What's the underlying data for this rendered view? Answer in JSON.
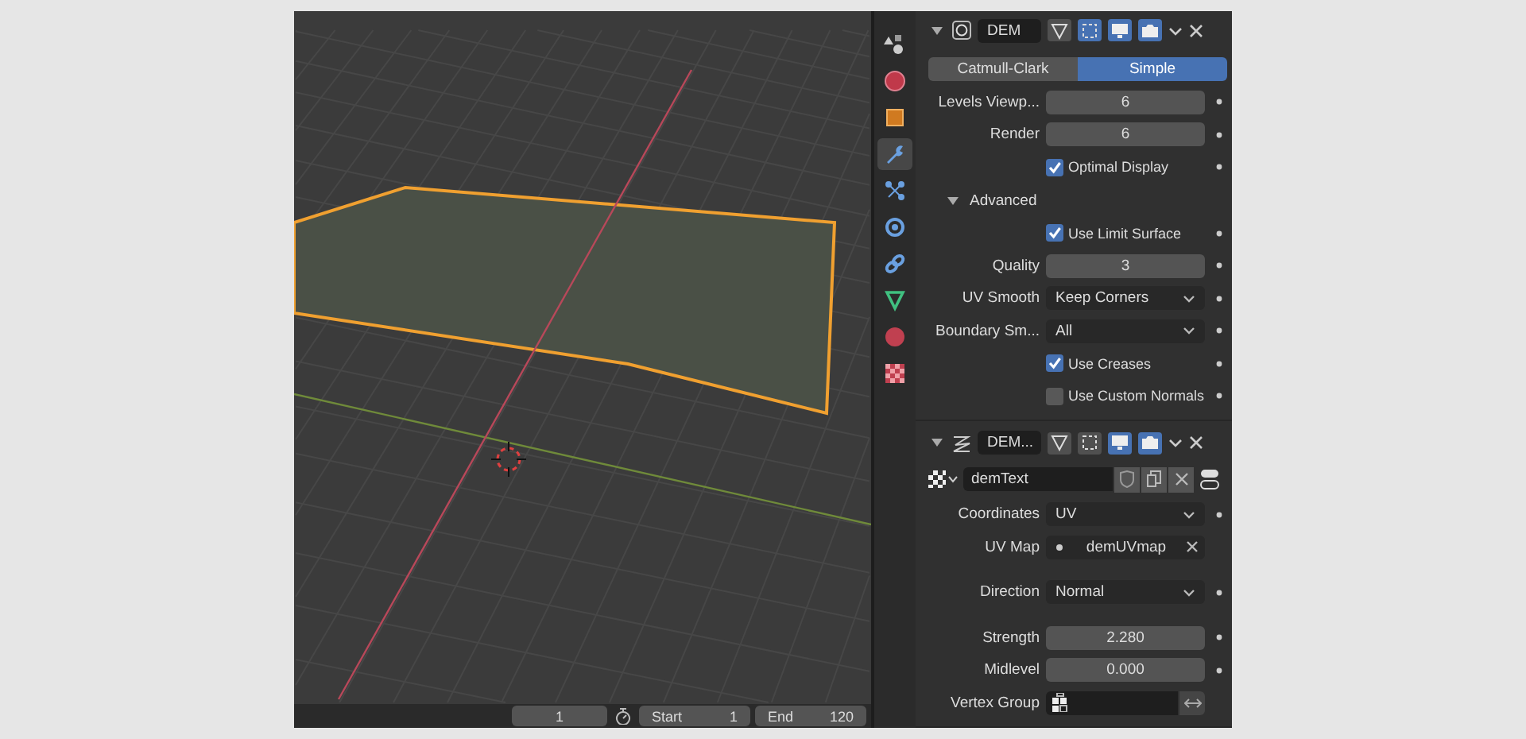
{
  "viewport": {
    "timeline": {
      "current_frame": "1",
      "start_label": "Start",
      "start": "1",
      "end_label": "End",
      "end": "120"
    }
  },
  "property_tabs": [
    {
      "kind": "scene",
      "selected": false
    },
    {
      "kind": "world",
      "selected": false
    },
    {
      "kind": "object",
      "selected": false
    },
    {
      "kind": "modifier",
      "selected": true
    },
    {
      "kind": "particles",
      "selected": false
    },
    {
      "kind": "physics",
      "selected": false
    },
    {
      "kind": "constraints",
      "selected": false
    },
    {
      "kind": "data",
      "selected": false
    },
    {
      "kind": "material",
      "selected": false
    },
    {
      "kind": "texture",
      "selected": false
    }
  ],
  "modifiers": [
    {
      "kind": "subdivision",
      "name": "DEM",
      "expanded": true,
      "toggles": [
        {
          "kind": "edit_mode",
          "on": false
        },
        {
          "kind": "cage",
          "on": true
        },
        {
          "kind": "viewport",
          "on": true
        },
        {
          "kind": "render",
          "on": true
        }
      ],
      "mode_tabs": [
        {
          "label": "Catmull-Clark",
          "selected": false
        },
        {
          "label": "Simple",
          "selected": true
        }
      ],
      "rows": [
        {
          "kind": "number",
          "label": "Levels Viewp...",
          "value": "6"
        },
        {
          "kind": "number",
          "label": "Render",
          "value": "6"
        },
        {
          "kind": "checkbox",
          "label": "Optimal Display",
          "checked": true
        },
        {
          "kind": "subpanel",
          "label": "Advanced",
          "expanded": true,
          "rows": [
            {
              "kind": "checkbox",
              "label": "Use Limit Surface",
              "checked": true
            },
            {
              "kind": "number",
              "label": "Quality",
              "value": "3"
            },
            {
              "kind": "dropdown",
              "label": "UV Smooth",
              "value": "Keep Corners"
            },
            {
              "kind": "dropdown",
              "label": "Boundary Sm...",
              "value": "All"
            },
            {
              "kind": "checkbox",
              "label": "Use Creases",
              "checked": true
            },
            {
              "kind": "checkbox",
              "label": "Use Custom Normals",
              "checked": false
            }
          ]
        }
      ]
    },
    {
      "kind": "displace",
      "name": "DEM...",
      "expanded": true,
      "toggles": [
        {
          "kind": "edit_mode",
          "on": false
        },
        {
          "kind": "cage",
          "on": false
        },
        {
          "kind": "viewport",
          "on": true
        },
        {
          "kind": "render",
          "on": true
        }
      ],
      "texture": {
        "name": "demText"
      },
      "rows": [
        {
          "kind": "dropdown",
          "label": "Coordinates",
          "value": "UV"
        },
        {
          "kind": "uvmap",
          "label": "UV Map",
          "value": "demUVmap"
        },
        {
          "kind": "dropdown",
          "label": "Direction",
          "value": "Normal"
        },
        {
          "kind": "number",
          "label": "Strength",
          "value": "2.280"
        },
        {
          "kind": "number",
          "label": "Midlevel",
          "value": "0.000"
        },
        {
          "kind": "vertex_group",
          "label": "Vertex Group"
        }
      ]
    }
  ]
}
